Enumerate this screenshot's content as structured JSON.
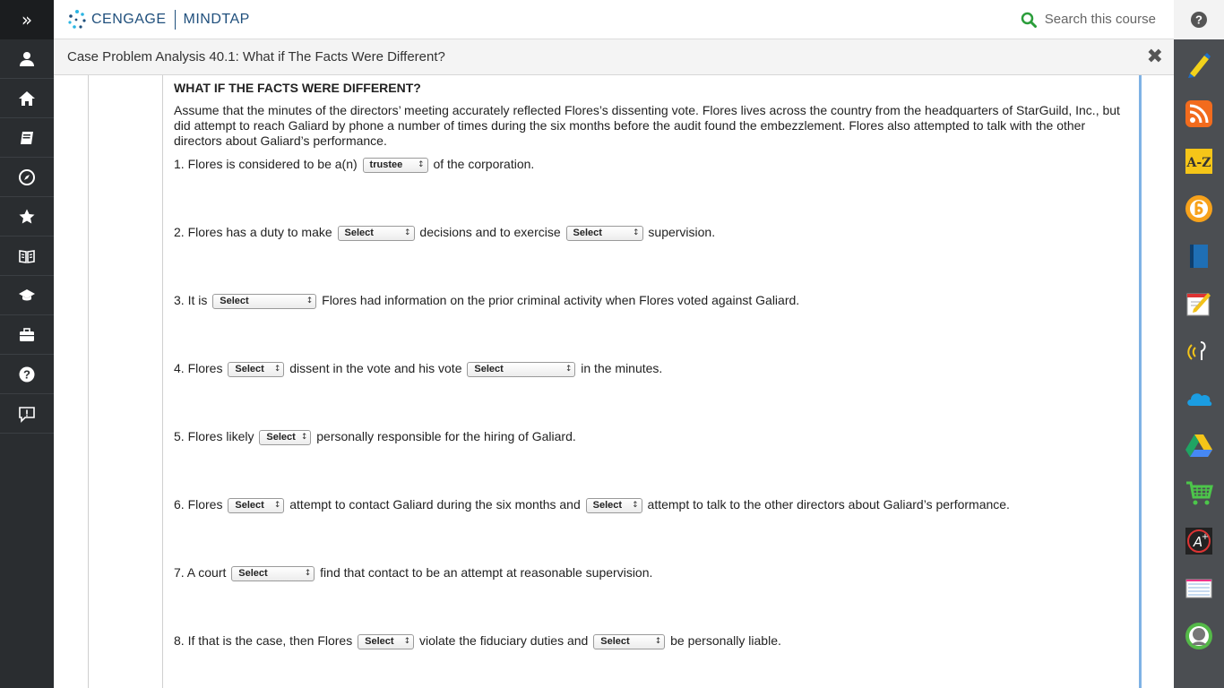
{
  "header": {
    "brand_cengage": "CENGAGE",
    "brand_mindtap": "MINDTAP",
    "search_placeholder": "Search this course"
  },
  "left_rail": {
    "toggle_glyph": "»",
    "icons": [
      "user-icon",
      "home-icon",
      "notebook-icon",
      "compass-icon",
      "star-icon",
      "open-book-icon",
      "graduation-cap-icon",
      "briefcase-icon",
      "help-icon",
      "feedback-icon"
    ]
  },
  "right_dock": {
    "apps": [
      "highlighter-app",
      "rss-app",
      "a-z-glossary-app",
      "readspeaker-app",
      "ebook-app",
      "notes-app",
      "audio-app",
      "onedrive-app",
      "google-drive-app",
      "cart-app",
      "aplus-app",
      "flashcards-app",
      "profile-app"
    ]
  },
  "activity": {
    "title": "Case Problem Analysis 40.1: What if The Facts Were Different?",
    "close_glyph": "✖"
  },
  "question": {
    "heading": "WHAT IF THE FACTS WERE DIFFERENT?",
    "paragraph": "Assume that the minutes of the directors’ meeting accurately reflected Flores’s dissenting vote. Flores lives across the country from the headquarters of StarGuild, Inc., but did attempt to reach Galiard by phone a number of times during the six months before the audit found the embezzlement. Flores also attempted to talk with the other directors about Galiard’s performance.",
    "items": [
      {
        "t1": "1. Flores is considered to be a(n)",
        "s1": "trustee",
        "t2": "of the corporation."
      },
      {
        "t1": "2. Flores has a duty to make",
        "s1": "Select",
        "t2": "decisions and to exercise",
        "s2": "Select",
        "t3": "supervision."
      },
      {
        "t1": "3. It is",
        "s1": "Select",
        "t2": "Flores had information on the prior criminal activity when Flores voted against Galiard."
      },
      {
        "t1": "4. Flores",
        "s1": "Select",
        "t2": "dissent in the vote and his vote",
        "s2": "Select",
        "t3": "in the minutes."
      },
      {
        "t1": "5. Flores likely",
        "s1": "Select",
        "t2": "personally responsible for the hiring of Galiard."
      },
      {
        "t1": "6. Flores",
        "s1": "Select",
        "t2": "attempt to contact Galiard during the six months and",
        "s2": "Select",
        "t3": "attempt to talk to the other directors about Galiard’s performance."
      },
      {
        "t1": "7. A court",
        "s1": "Select",
        "t2": "find that contact to be an attempt at reasonable supervision."
      },
      {
        "t1": "8. If that is the case, then Flores",
        "s1": "Select",
        "t2": "violate the fiduciary duties and",
        "s2": "Select",
        "t3": "be personally liable."
      }
    ]
  },
  "colors": {
    "rail_bg": "#2a2d30",
    "dock_bg": "#4b4e52",
    "brand": "#1f4f7c",
    "search_icon": "#2a9d3a",
    "frame_accent": "#7fb2e5"
  }
}
